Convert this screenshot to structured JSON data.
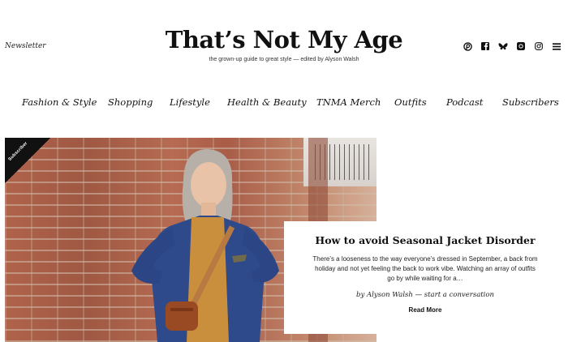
{
  "header": {
    "newsletter_label": "Newsletter",
    "site_title": "That’s Not My Age",
    "tagline": "the grown-up guide to great style — edited by Alyson Walsh",
    "social_icons": [
      "pinterest-icon",
      "facebook-icon",
      "bluesky-icon",
      "threads-icon",
      "instagram-icon",
      "menu-icon"
    ]
  },
  "nav": {
    "items": [
      "Fashion & Style",
      "Shopping",
      "Lifestyle",
      "Health & Beauty",
      "TNMA Merch",
      "Outfits",
      "Podcast",
      "Subscribers"
    ]
  },
  "feature": {
    "ribbon_label": "Subscriber",
    "title": "How to avoid Seasonal Jacket Disorder",
    "excerpt": "There’s a looseness to the way everyone’s dressed in September, a back from holiday and not yet feeling the back to work vibe. Watching an array of outfits go by while waiting for a…",
    "byline": "by Alyson Walsh — start a conversation",
    "read_more_label": "Read More"
  }
}
